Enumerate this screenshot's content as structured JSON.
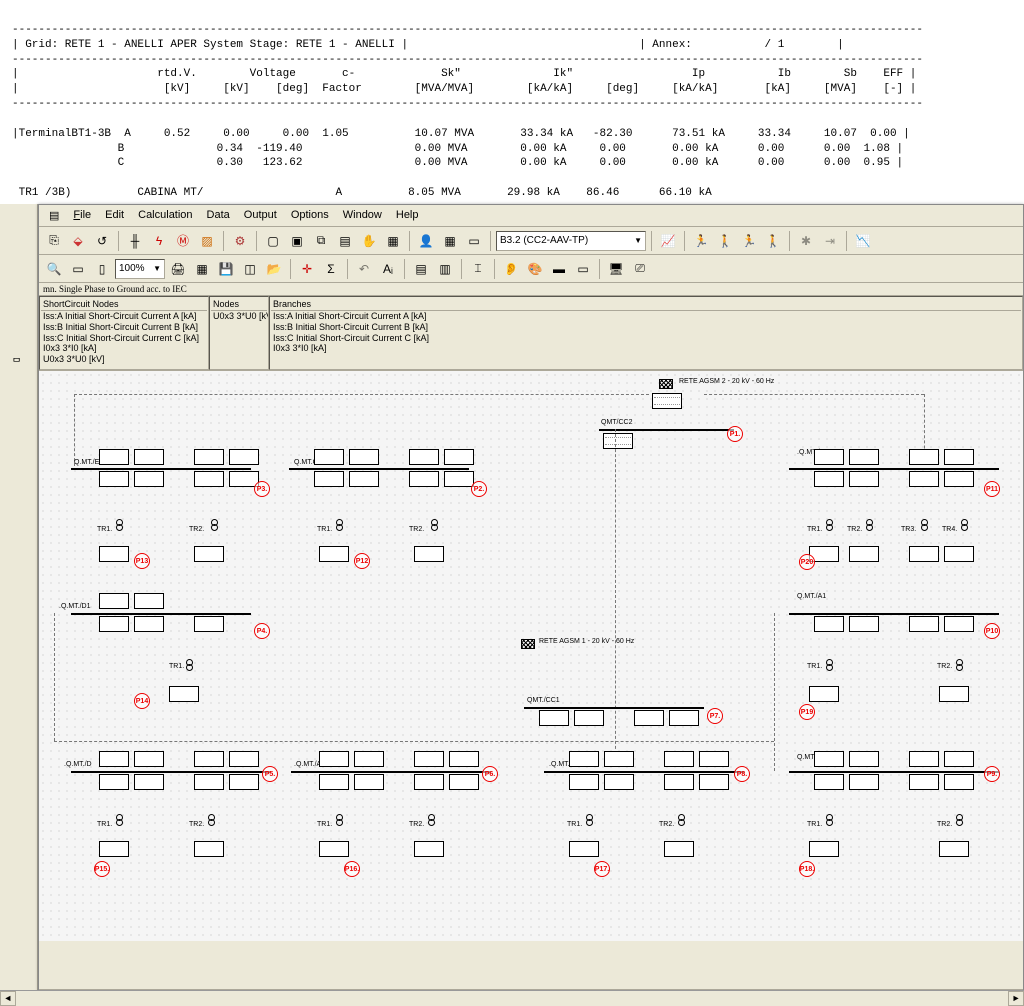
{
  "report": {
    "header": "| Grid: RETE 1 - ANELLI APER System Stage: RETE 1 - ANELLI |                                   | Annex:           / 1        |",
    "cols1": "|                     rtd.V.        Voltage       c-             Sk\"              Ik\"                  Ip           Ib        Sb    EFF |",
    "cols2": "|                      [kV]     [kV]    [deg]  Factor        [MVA/MVA]        [kA/kA]     [deg]     [kA/kA]       [kA]     [MVA]    [-] |",
    "rowA": "|TerminalBT1-3B  A     0.52     0.00     0.00  1.05          10.07 MVA       33.34 kA   -82.30      73.51 kA     33.34     10.07  0.00 |",
    "rowB": "                B              0.34  -119.40                 0.00 MVA        0.00 kA     0.00       0.00 kA      0.00      0.00  1.08 |",
    "rowC": "                C              0.30   123.62                 0.00 MVA        0.00 kA     0.00       0.00 kA      0.00      0.00  0.95 |",
    "cut": " TR1 /3B)          CABINA MT/                    A          8.05 MVA       29.98 kA    86.46      66.10 kA"
  },
  "menu": {
    "file": "File",
    "edit": "Edit",
    "calculation": "Calculation",
    "data": "Data",
    "output": "Output",
    "options": "Options",
    "window": "Window",
    "help": "Help"
  },
  "toolbar": {
    "zoom": "100%",
    "combo": "B3.2 (CC2-AAV-TP)"
  },
  "panels": {
    "title": "mn. Single Phase to Ground acc. to IEC",
    "p1": {
      "h": "ShortCircuit Nodes",
      "lines": [
        "Iss:A Initial Short-Circuit Current A [kA]",
        "Iss:B Initial Short-Circuit Current B [kA]",
        "Iss:C Initial Short-Circuit Current C [kA]",
        "I0x3 3*I0 [kA]",
        "U0x3 3*U0 [kV]"
      ]
    },
    "p2": {
      "h": "Nodes",
      "lines": [
        "U0x3 3*U0 [kV]"
      ]
    },
    "p3": {
      "h": "Branches",
      "lines": [
        "Iss:A Initial Short-Circuit Current A [kA]",
        "Iss:B Initial Short-Circuit Current B [kA]",
        "Iss:C Initial Short-Circuit Current C [kA]",
        "I0x3 3*I0 [kA]"
      ]
    }
  },
  "diagram": {
    "ext1": "RETE AGSM 2 - 20 kV - 60 Hz",
    "ext2": "RETE AGSM 1 - 20 kV - 60 Hz",
    "cc2": "QMT/CC2",
    "cc1": "QMT./CC1",
    "busE": "Q.MT./E",
    "busC": "Q.MT.C",
    "busD1": ".Q.MT./D1",
    "busD": ".Q.MT./D",
    "busA": ".Q.MT./A",
    "busF": ".Q.MT./F",
    "busB": ".Q.MT./B",
    "busA1": "Q.MT./A1",
    "busPT": "Q.MT./PT",
    "tr1": "TR1.",
    "tr2": "TR2.",
    "tr3": "TR3.",
    "tr4": "TR4.",
    "probes": {
      "p1": "P1.",
      "p2": "P2.",
      "p3": "P3.",
      "p4": "P4.",
      "p5": "P5.",
      "p6": "P6.",
      "p7": "P7.",
      "p8": "P8.",
      "p9": "P9.",
      "p10": "P10",
      "p11": "P11",
      "p12": "P12",
      "p13": "P13",
      "p14": "P14",
      "p15": "P15.",
      "p16": "P16.",
      "p17": "P17.",
      "p18": "P18.",
      "p19": "P19",
      "p20": "P20"
    }
  }
}
